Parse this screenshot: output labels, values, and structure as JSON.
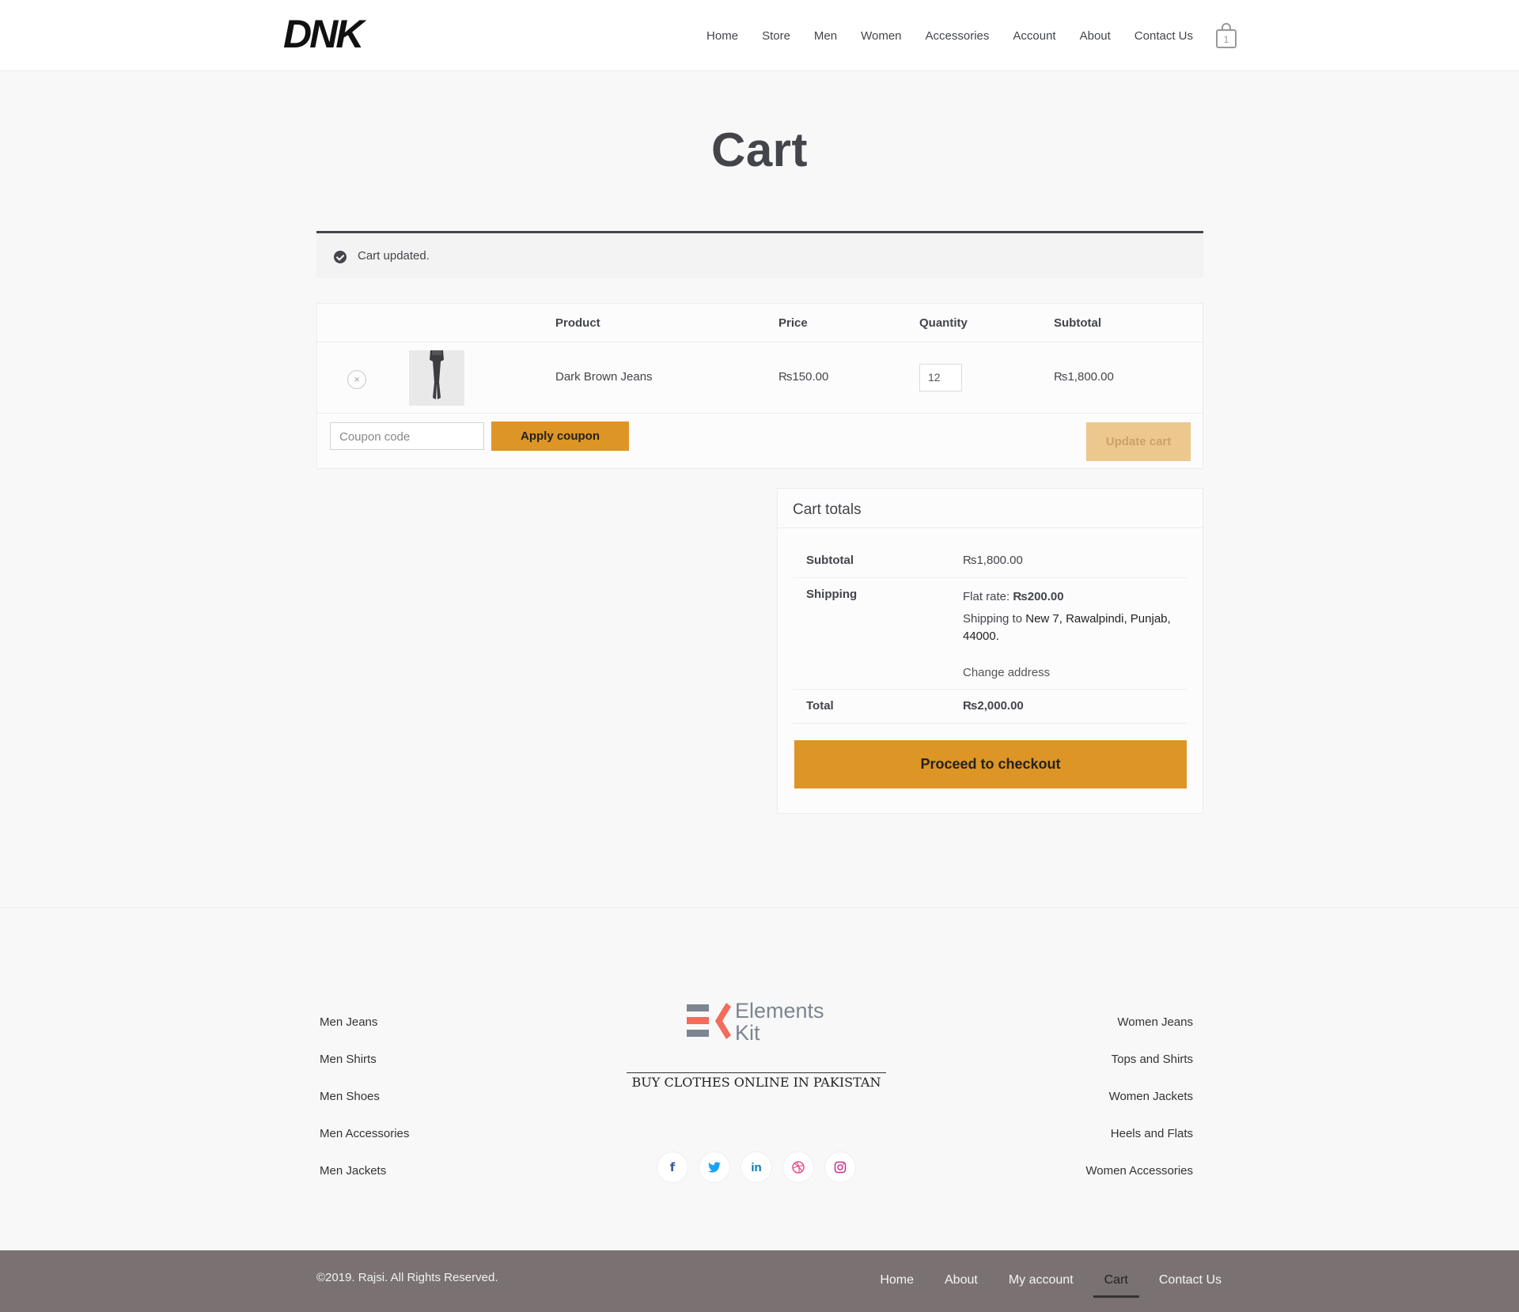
{
  "header": {
    "nav": [
      "Home",
      "Store",
      "Men",
      "Women",
      "Accessories",
      "Account",
      "About",
      "Contact Us"
    ],
    "cart_count": "1"
  },
  "page": {
    "title": "Cart",
    "notice": "Cart updated."
  },
  "cart_table": {
    "headers": {
      "product": "Product",
      "price": "Price",
      "quantity": "Quantity",
      "subtotal": "Subtotal"
    },
    "items": [
      {
        "remove": "×",
        "name": "Dark Brown Jeans",
        "price": "₨150.00",
        "quantity": "12",
        "subtotal": "₨1,800.00"
      }
    ],
    "coupon_placeholder": "Coupon code",
    "apply_coupon": "Apply coupon",
    "update_cart": "Update cart"
  },
  "totals": {
    "title": "Cart totals",
    "subtotal_label": "Subtotal",
    "subtotal_value": "₨1,800.00",
    "shipping_label": "Shipping",
    "flat_rate_label": "Flat rate:",
    "flat_rate_value": "₨200.00",
    "shipping_to_label": "Shipping to",
    "shipping_address_line1": "New 7, Rawalpindi, Punjab,",
    "shipping_address_line2": "44000.",
    "change_address": "Change address",
    "total_label": "Total",
    "total_value": "₨2,000.00",
    "checkout": "Proceed to checkout"
  },
  "footer": {
    "left_links": [
      "Men Jeans",
      "Men Shirts",
      "Men Shoes",
      "Men Accessories",
      "Men Jackets"
    ],
    "right_links": [
      "Women Jeans",
      "Tops and Shirts",
      "Women Jackets",
      "Heels and Flats",
      "Women Accessories"
    ],
    "logo_text_line1": "Elements",
    "logo_text_line2": "Kit",
    "tagline": "BUY CLOTHES ONLINE IN PAKISTAN",
    "social_icons": [
      "facebook-icon",
      "twitter-icon",
      "linkedin-icon",
      "dribbble-icon",
      "instagram-icon"
    ]
  },
  "bottom_bar": {
    "copyright": "©2019. Rajsi. All Rights Reserved.",
    "nav": [
      "Home",
      "About",
      "My account",
      "Cart",
      "Contact Us"
    ],
    "active": "Cart"
  },
  "colors": {
    "accent": "#dd9526",
    "accent_disabled": "#ecc78e",
    "bottom_bar": "#7a7272",
    "text": "#43454b"
  }
}
